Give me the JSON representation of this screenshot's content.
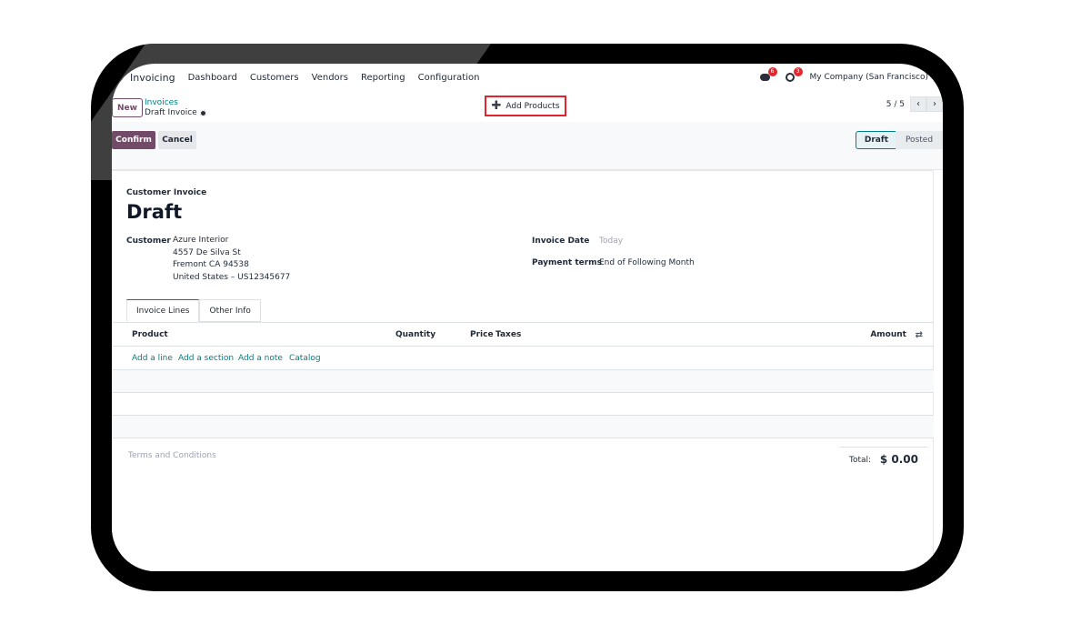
{
  "navbar": {
    "app_name": "Invoicing",
    "menu": [
      "Dashboard",
      "Customers",
      "Vendors",
      "Reporting",
      "Configuration"
    ],
    "messages_badge": "6",
    "activities_badge": "3",
    "company": "My Company (San Francisco)"
  },
  "control": {
    "new_label": "New",
    "breadcrumb_parent": "Invoices",
    "breadcrumb_current": "Draft Invoice",
    "add_products_label": "Add Products",
    "pager_value": "5 / 5",
    "pager_prev": "‹",
    "pager_next": "›"
  },
  "statusbar": {
    "confirm_label": "Confirm",
    "cancel_label": "Cancel",
    "stages": [
      "Draft",
      "Posted"
    ],
    "active_stage": "Draft"
  },
  "form": {
    "doc_type": "Customer Invoice",
    "title": "Draft",
    "customer_label": "Customer",
    "customer_lines": [
      "Azure Interior",
      "4557 De Silva St",
      "Fremont CA 94538",
      "United States – US12345677"
    ],
    "invoice_date_label": "Invoice Date",
    "invoice_date_value": "Today",
    "payment_terms_label": "Payment terms",
    "payment_terms_value": "End of Following Month"
  },
  "tabs": [
    "Invoice Lines",
    "Other Info"
  ],
  "table": {
    "columns": [
      "Product",
      "Quantity",
      "Price",
      "Taxes",
      "Amount"
    ],
    "add_links": [
      "Add a line",
      "Add a section",
      "Add a note",
      "Catalog"
    ]
  },
  "footer": {
    "terms_placeholder": "Terms and Conditions",
    "total_label": "Total:",
    "total_value": "$ 0.00"
  },
  "colors": {
    "brand": "#714b67",
    "link": "#017e84",
    "highlight_box": "#e3222b",
    "badge": "#e2282e"
  }
}
